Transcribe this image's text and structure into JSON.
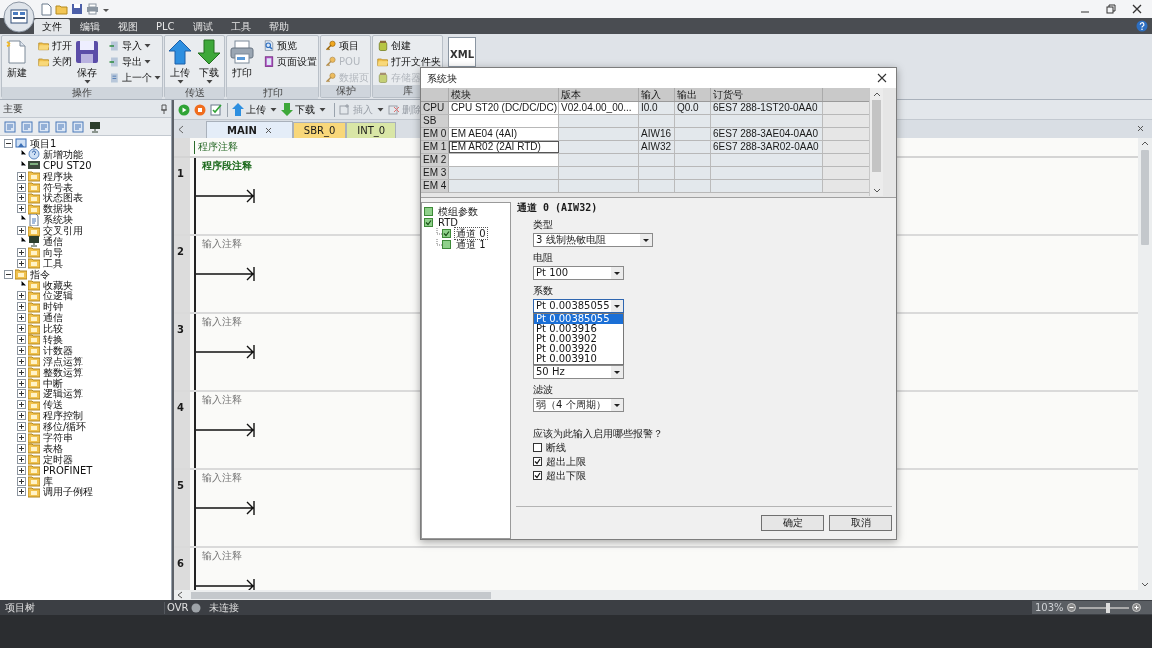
{
  "ribbon": {
    "tabs": [
      {
        "label": "文件",
        "selected": true
      },
      {
        "label": "编辑",
        "selected": false
      },
      {
        "label": "视图",
        "selected": false
      },
      {
        "label": "PLC",
        "selected": false
      },
      {
        "label": "调试",
        "selected": false
      },
      {
        "label": "工具",
        "selected": false
      },
      {
        "label": "帮助",
        "selected": false
      }
    ],
    "groups": [
      {
        "label": "操作",
        "buttons": [
          {
            "label": "新建",
            "kind": "large",
            "disabled": false,
            "dropdown": false
          },
          {
            "label": "打开",
            "kind": "small",
            "disabled": false,
            "dropdown": false
          },
          {
            "label": "关闭",
            "kind": "small",
            "disabled": false,
            "dropdown": false
          },
          {
            "label": "保存",
            "kind": "large",
            "disabled": false,
            "dropdown": true
          },
          {
            "label": "导入",
            "kind": "small",
            "disabled": false,
            "dropdown": true
          },
          {
            "label": "导出",
            "kind": "small",
            "disabled": false,
            "dropdown": true
          },
          {
            "label": "上一个",
            "kind": "small",
            "disabled": false,
            "dropdown": true
          }
        ]
      },
      {
        "label": "传送",
        "buttons": [
          {
            "label": "上传",
            "kind": "large",
            "disabled": false,
            "dropdown": true
          },
          {
            "label": "下载",
            "kind": "large",
            "disabled": false,
            "dropdown": true
          }
        ]
      },
      {
        "label": "打印",
        "buttons": [
          {
            "label": "打印",
            "kind": "large",
            "disabled": false,
            "dropdown": false
          },
          {
            "label": "预览",
            "kind": "small",
            "disabled": false,
            "dropdown": false
          },
          {
            "label": "页面设置",
            "kind": "small",
            "disabled": false,
            "dropdown": false
          }
        ]
      },
      {
        "label": "保护",
        "buttons": [
          {
            "label": "项目",
            "kind": "small",
            "disabled": false,
            "dropdown": false
          },
          {
            "label": "POU",
            "kind": "small",
            "disabled": true,
            "dropdown": false
          },
          {
            "label": "数据页",
            "kind": "small",
            "disabled": true,
            "dropdown": false
          }
        ]
      },
      {
        "label": "库",
        "buttons": [
          {
            "label": "创建",
            "kind": "small",
            "disabled": false,
            "dropdown": false
          },
          {
            "label": "打开文件夹",
            "kind": "small",
            "disabled": false,
            "dropdown": false
          },
          {
            "label": "存储器",
            "kind": "small",
            "disabled": true,
            "dropdown": false
          }
        ]
      }
    ],
    "extra_button": {
      "label": "XML"
    }
  },
  "project_panel": {
    "title": "主要",
    "tree": [
      {
        "label": "项目1",
        "kind": "project",
        "expanded": true,
        "children": [
          {
            "label": "新增功能",
            "kind": "help"
          },
          {
            "label": "CPU ST20",
            "kind": "cpu"
          },
          {
            "label": "程序块",
            "kind": "folder",
            "expanded": false
          },
          {
            "label": "符号表",
            "kind": "folder",
            "expanded": false
          },
          {
            "label": "状态图表",
            "kind": "folder",
            "expanded": false
          },
          {
            "label": "数据块",
            "kind": "folder",
            "expanded": false
          },
          {
            "label": "系统块",
            "kind": "doc"
          },
          {
            "label": "交叉引用",
            "kind": "folder",
            "expanded": false
          },
          {
            "label": "通信",
            "kind": "comm"
          },
          {
            "label": "向导",
            "kind": "folder",
            "expanded": false
          },
          {
            "label": "工具",
            "kind": "folder",
            "expanded": false
          }
        ]
      },
      {
        "label": "指令",
        "kind": "folder",
        "expanded": true,
        "children": [
          {
            "label": "收藏夹",
            "kind": "folder"
          },
          {
            "label": "位逻辑",
            "kind": "folder",
            "expanded": false
          },
          {
            "label": "时钟",
            "kind": "folder",
            "expanded": false
          },
          {
            "label": "通信",
            "kind": "folder",
            "expanded": false
          },
          {
            "label": "比较",
            "kind": "folder",
            "expanded": false
          },
          {
            "label": "转换",
            "kind": "folder",
            "expanded": false
          },
          {
            "label": "计数器",
            "kind": "folder",
            "expanded": false
          },
          {
            "label": "浮点运算",
            "kind": "folder",
            "expanded": false
          },
          {
            "label": "整数运算",
            "kind": "folder",
            "expanded": false
          },
          {
            "label": "中断",
            "kind": "folder",
            "expanded": false
          },
          {
            "label": "逻辑运算",
            "kind": "folder",
            "expanded": false
          },
          {
            "label": "传送",
            "kind": "folder",
            "expanded": false
          },
          {
            "label": "程序控制",
            "kind": "folder",
            "expanded": false
          },
          {
            "label": "移位/循环",
            "kind": "folder",
            "expanded": false
          },
          {
            "label": "字符串",
            "kind": "folder",
            "expanded": false
          },
          {
            "label": "表格",
            "kind": "folder",
            "expanded": false
          },
          {
            "label": "定时器",
            "kind": "folder",
            "expanded": false
          },
          {
            "label": "PROFINET",
            "kind": "folder",
            "expanded": false
          },
          {
            "label": "库",
            "kind": "folder",
            "expanded": false
          },
          {
            "label": "调用子例程",
            "kind": "folder",
            "expanded": false
          }
        ]
      }
    ]
  },
  "editor": {
    "toolbar": [
      {
        "label": "上传",
        "disabled": false
      },
      {
        "label": "下载",
        "disabled": false
      },
      {
        "label": "插入",
        "disabled": true
      },
      {
        "label": "删除",
        "disabled": true
      }
    ],
    "tabs": [
      {
        "label": "MAIN",
        "selected": true,
        "color": "#e4edf8"
      },
      {
        "label": "SBR_0",
        "selected": false,
        "color": "#f8d77a"
      },
      {
        "label": "INT_0",
        "selected": false,
        "color": "#d9e6a6"
      }
    ],
    "program_comment": "程序注释",
    "networks": [
      {
        "number": "1",
        "comment": "程序段注释"
      },
      {
        "number": "2",
        "placeholder": "输入注释"
      },
      {
        "number": "3",
        "placeholder": "输入注释"
      },
      {
        "number": "4",
        "placeholder": "输入注释"
      },
      {
        "number": "5",
        "placeholder": "输入注释"
      },
      {
        "number": "6",
        "placeholder": "输入注释"
      }
    ]
  },
  "status_bar": {
    "panel": "项目树",
    "mode": "OVR",
    "connection": "未连接",
    "zoom": "103%",
    "zoom_level": {
      "level": 0.6
    }
  },
  "dialog": {
    "title": "系统块",
    "table": {
      "columns": [
        "模块",
        "版本",
        "输入",
        "输出",
        "订货号"
      ],
      "rows": [
        {
          "slot": "CPU",
          "module": "CPU ST20 (DC/DC/DC)",
          "version": "V02.04.00_00...",
          "input": "I0.0",
          "output": "Q0.0",
          "order_no": "6ES7 288-1ST20-0AA0",
          "selected": false
        },
        {
          "slot": "SB",
          "selected": false
        },
        {
          "slot": "EM 0",
          "module": "EM AE04 (4AI)",
          "input": "AIW16",
          "order_no": "6ES7 288-3AE04-0AA0",
          "selected": false
        },
        {
          "slot": "EM 1",
          "module": "EM AR02 (2AI RTD)",
          "input": "AIW32",
          "order_no": "6ES7 288-3AR02-0AA0",
          "selected": true
        },
        {
          "slot": "EM 2",
          "selected": false
        },
        {
          "slot": "EM 3",
          "selected": false
        },
        {
          "slot": "EM 4",
          "selected": false
        }
      ]
    },
    "tree": [
      {
        "label": "模组参数",
        "checked": false,
        "selected": false
      },
      {
        "label": "RTD",
        "checked": true,
        "selected": false,
        "children": [
          {
            "label": "通道 0",
            "checked": true,
            "selected": true
          },
          {
            "label": "通道 1",
            "checked": false,
            "selected": false
          }
        ]
      }
    ],
    "heading": "通道 0 (AIW32)",
    "fields": [
      {
        "label": "类型",
        "value": "3 线制热敏电阻",
        "open": false
      },
      {
        "label": "电阻",
        "value": "Pt 100",
        "open": false
      },
      {
        "label": "系数",
        "value": "Pt 0.00385055",
        "open": true,
        "options": [
          {
            "label": "Pt 0.00385055",
            "selected": true
          },
          {
            "label": "Pt 0.003916",
            "selected": false
          },
          {
            "label": "Pt 0.003902",
            "selected": false
          },
          {
            "label": "Pt 0.003920",
            "selected": false
          },
          {
            "label": "Pt 0.003910",
            "selected": false
          }
        ]
      },
      {
        "value": "50 Hz",
        "open": false
      },
      {
        "label": "滤波",
        "value": "弱（4 个周期）",
        "open": false
      }
    ],
    "alarms": {
      "question": "应该为此输入启用哪些报警？",
      "options": [
        {
          "label": "断线",
          "checked": false
        },
        {
          "label": "超出上限",
          "checked": true
        },
        {
          "label": "超出下限",
          "checked": true
        }
      ]
    },
    "buttons": [
      "确定",
      "取消"
    ]
  }
}
